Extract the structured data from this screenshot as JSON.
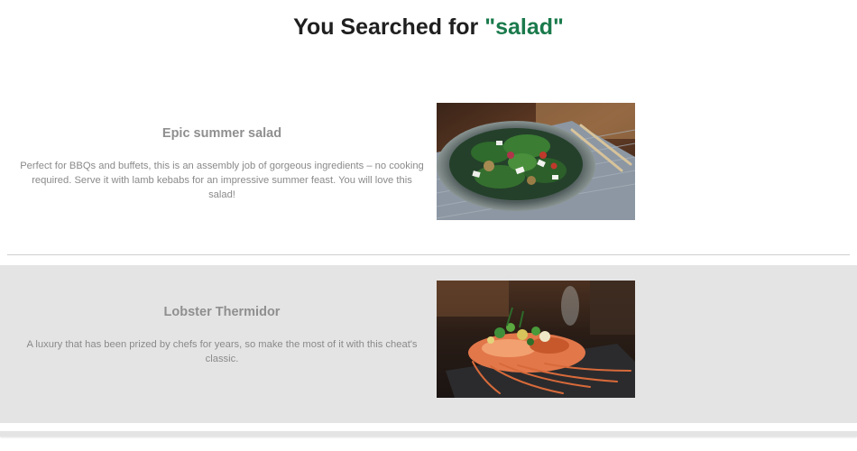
{
  "heading": {
    "prefix": "You Searched for ",
    "term": "\"salad\""
  },
  "colors": {
    "accent": "#1a7a4c",
    "alt_row": "#e4e4e4",
    "muted_text": "#8a8a8a"
  },
  "results": [
    {
      "title": "Epic summer salad",
      "description": "Perfect for BBQs and buffets, this is an assembly job of gorgeous ingredients – no cooking required. Serve it with lamb kebabs for an impressive summer feast. You will love this salad!",
      "image": "salad-photo"
    },
    {
      "title": "Lobster Thermidor",
      "description": "A luxury that has been prized by chefs for years, so make the most of it with this cheat's classic.",
      "image": "lobster-photo"
    }
  ]
}
